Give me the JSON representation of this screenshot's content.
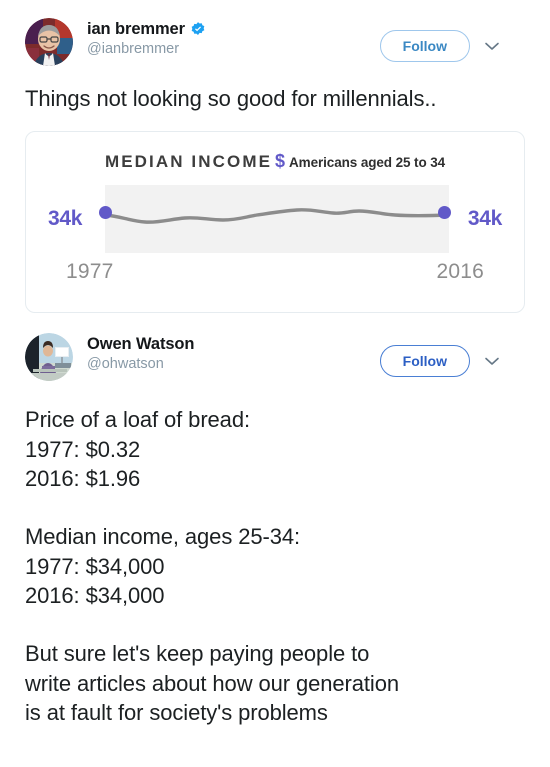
{
  "tweets": [
    {
      "display_name": "ian bremmer",
      "handle": "@ianbremmer",
      "verified": true,
      "verified_icon": "verified-badge-icon",
      "follow_label": "Follow",
      "caret_icon": "chevron-down-icon",
      "text": "Things not looking so good for millennials..",
      "avatar_icon": "avatar-ian-bremmer"
    },
    {
      "display_name": "Owen Watson",
      "handle": "@ohwatson",
      "verified": false,
      "follow_label": "Follow",
      "caret_icon": "chevron-down-icon",
      "text": "Price of a loaf of bread:\n1977: $0.32\n2016: $1.96\n\nMedian income, ages 25-34:\n1977: $34,000\n2016: $34,000\n\nBut sure let's keep paying people to\nwrite articles about how our generation\nis at fault for society's problems",
      "avatar_icon": "avatar-owen-watson"
    }
  ],
  "card": {
    "title_main": "MEDIAN INCOME",
    "title_dollar": "$",
    "title_sub": "Americans aged 25 to 34",
    "label_left": "34k",
    "label_right": "34k",
    "year_left": "1977",
    "year_right": "2016"
  },
  "colors": {
    "accent_purple": "#6159c8",
    "line_gray": "#8c8c8c",
    "plot_background": "#f2f2f2",
    "follow_blue": "#3b88c3",
    "verified_blue": "#1da1f2",
    "text_primary": "#1c2022",
    "text_muted": "#8899a6"
  },
  "chart_data": {
    "type": "line",
    "title": "MEDIAN INCOME",
    "subtitle": "Americans aged 25 to 34",
    "xlabel": "",
    "ylabel": "",
    "grid": false,
    "legend": "none",
    "x": [
      1977,
      1979,
      1981,
      1983,
      1985,
      1987,
      1989,
      1991,
      1993,
      1995,
      1997,
      1999,
      2001,
      2003,
      2005,
      2007,
      2009,
      2011,
      2013,
      2016
    ],
    "xlim": [
      1977,
      2016
    ],
    "ylim": [
      30000,
      38000
    ],
    "series": [
      {
        "name": "Median income",
        "values": [
          34000,
          33600,
          33100,
          33000,
          33400,
          33500,
          33800,
          33400,
          33300,
          33600,
          34000,
          34500,
          34800,
          34600,
          34400,
          34700,
          34300,
          34100,
          34200,
          34000
        ]
      }
    ],
    "annotations": [
      {
        "x": 1977,
        "label": "34k",
        "value": 34000
      },
      {
        "x": 2016,
        "label": "34k",
        "value": 34000
      }
    ],
    "tick_labels": {
      "x": [
        "1977",
        "2016"
      ],
      "y": []
    }
  }
}
